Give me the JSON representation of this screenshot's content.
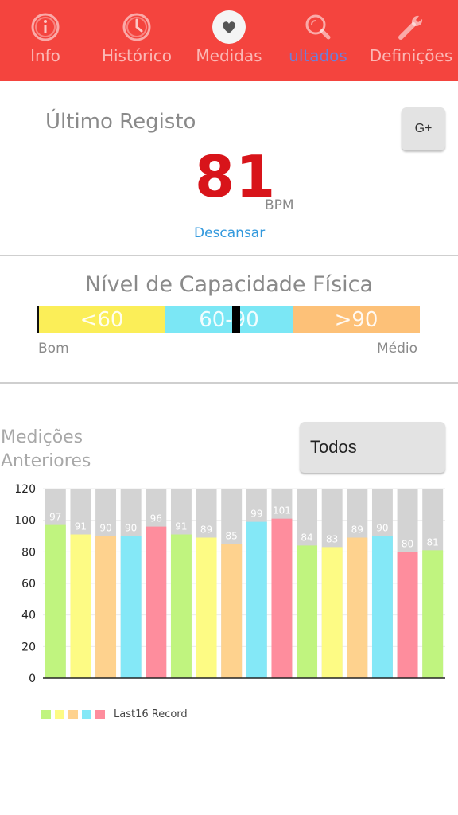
{
  "nav": {
    "items": [
      {
        "label": "Info",
        "icon": "info-icon"
      },
      {
        "label": "Histórico",
        "icon": "clock-icon"
      },
      {
        "label": "Medidas",
        "icon": "heart-icon"
      },
      {
        "label": "ultados",
        "icon": "magnifier-icon"
      },
      {
        "label": "Definições",
        "icon": "wrench-icon"
      }
    ],
    "active_index": 3,
    "bar_color": "#f4443e"
  },
  "last_record": {
    "title": "Último Registo",
    "value": "81",
    "unit": "BPM",
    "status": "Descansar",
    "gplus_label": "G+"
  },
  "fitness": {
    "title": "Nível de Capacidade Física",
    "segments": [
      {
        "label": "<60",
        "color": "#fbee58"
      },
      {
        "label": "60-90",
        "color": "#7be7f5"
      },
      {
        "label": ">90",
        "color": "#fdc178"
      }
    ],
    "left_label": "Bom",
    "right_label": "Médio"
  },
  "previous": {
    "title": "Medições Anteriores",
    "filter_label": "Todos"
  },
  "chart_data": {
    "type": "bar",
    "values": [
      97,
      91,
      90,
      90,
      96,
      91,
      89,
      85,
      99,
      101,
      84,
      83,
      89,
      90,
      80,
      81
    ],
    "bar_colors": [
      "#c0f47f",
      "#fdfb84",
      "#fed28e",
      "#84e8f7",
      "#fe8d9d"
    ],
    "background_color": "#d3d3d3",
    "ylim": [
      0,
      120
    ],
    "yticks": [
      0,
      20,
      40,
      60,
      80,
      100,
      120
    ],
    "legend": "Last16 Record"
  }
}
